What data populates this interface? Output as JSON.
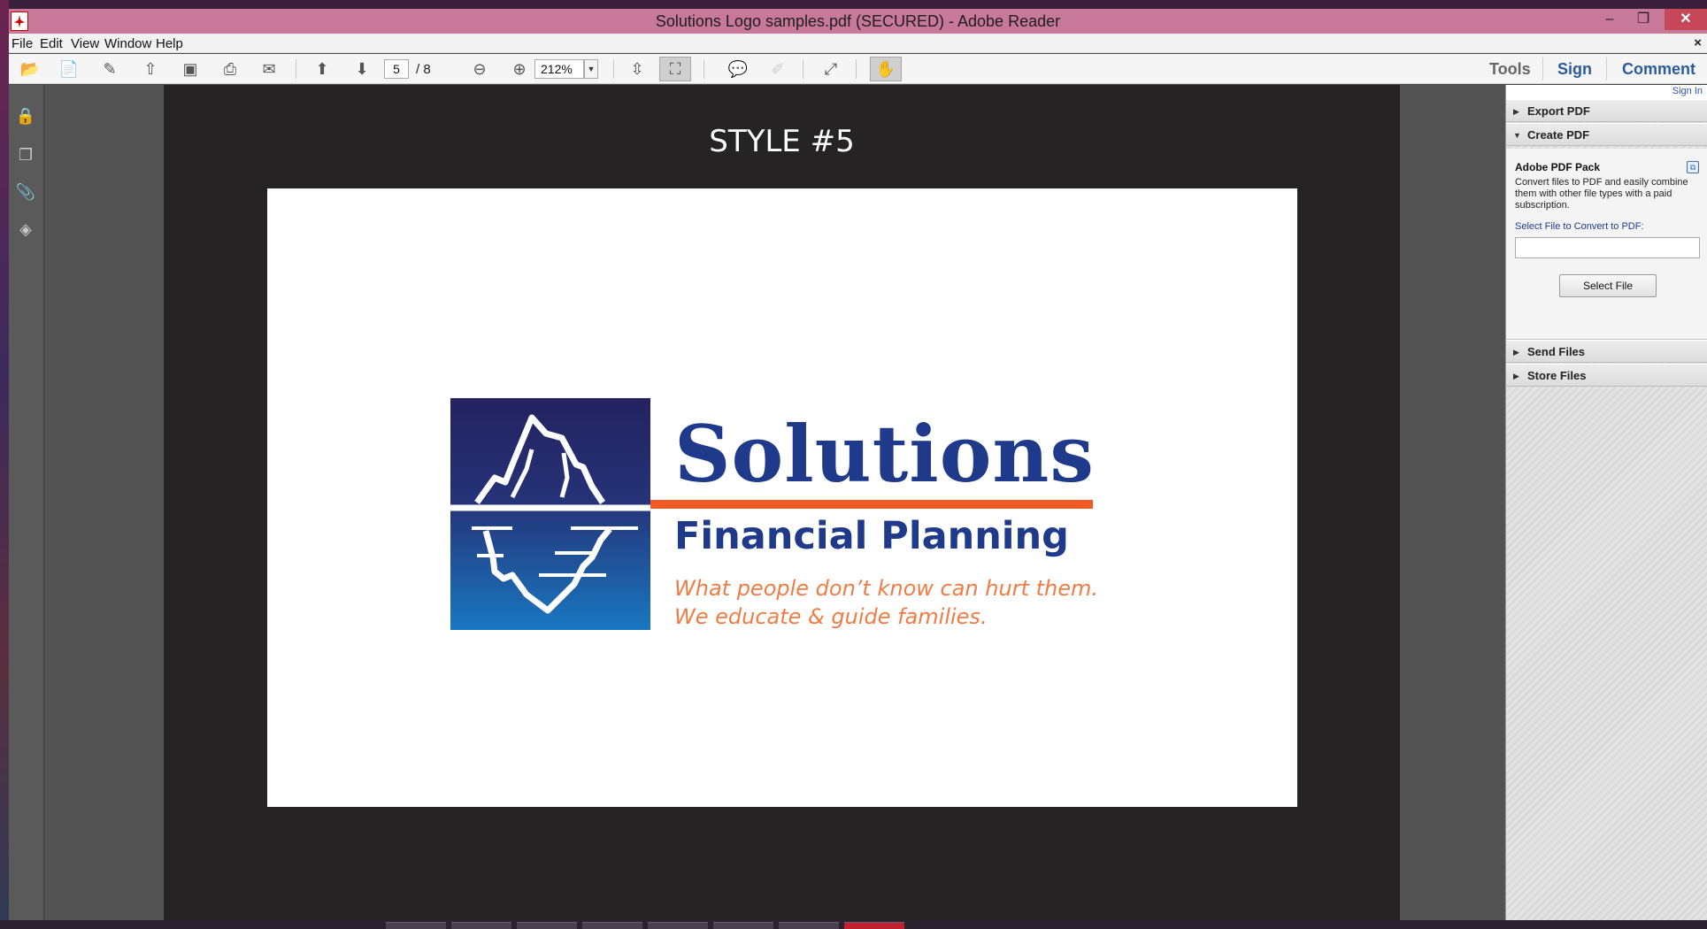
{
  "window": {
    "title": "Solutions Logo samples.pdf (SECURED) - Adobe Reader",
    "minimize": "–",
    "maximize": "❐",
    "close": "✕"
  },
  "menu": {
    "items": [
      "File",
      "Edit",
      "View",
      "Window",
      "Help"
    ],
    "close_doc": "×"
  },
  "toolbar": {
    "current_page": "5",
    "total_pages": "/ 8",
    "zoom": "212%",
    "tools_label": "Tools",
    "sign_label": "Sign",
    "comment_label": "Comment"
  },
  "document": {
    "heading": "STYLE #5",
    "logo": {
      "name": "Solutions",
      "subtitle": "Financial Planning",
      "tagline_1": "What people don’t know can hurt them.",
      "tagline_2": "We educate & guide families."
    }
  },
  "right_panel": {
    "sign_in": "Sign In",
    "sections": {
      "export_pdf": "Export PDF",
      "create_pdf": "Create PDF",
      "send_files": "Send Files",
      "store_files": "Store Files"
    },
    "pack_title": "Adobe PDF Pack",
    "pack_description": "Convert files to PDF and easily combine them with other file types with a paid subscription.",
    "select_label": "Select File to Convert to PDF:",
    "select_button": "Select File"
  },
  "colors": {
    "titlebar": "#c87898",
    "logo_blue": "#1f3a8a",
    "logo_orange": "#f15a24",
    "tagline_orange": "#f07c45"
  }
}
